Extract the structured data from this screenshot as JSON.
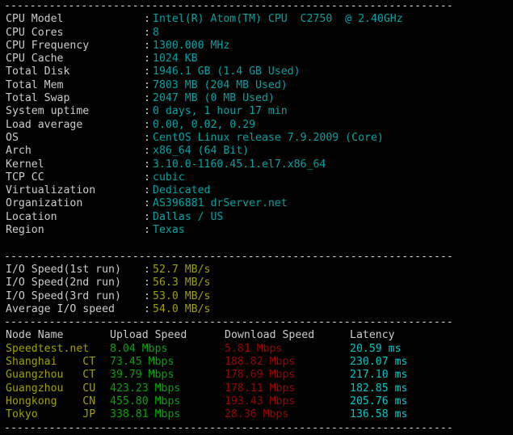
{
  "terminal": {
    "separator": "----------------------------------------------------------------------",
    "colon": ":"
  },
  "system_info": {
    "rows": [
      {
        "label": "CPU Model",
        "value": "Intel(R) Atom(TM) CPU  C2750  @ 2.40GHz"
      },
      {
        "label": "CPU Cores",
        "value": "8"
      },
      {
        "label": "CPU Frequency",
        "value": "1300.000 MHz"
      },
      {
        "label": "CPU Cache",
        "value": "1024 KB"
      },
      {
        "label": "Total Disk",
        "value": "1946.1 GB (1.4 GB Used)"
      },
      {
        "label": "Total Mem",
        "value": "7803 MB (204 MB Used)"
      },
      {
        "label": "Total Swap",
        "value": "2047 MB (0 MB Used)"
      },
      {
        "label": "System uptime",
        "value": "0 days, 1 hour 17 min"
      },
      {
        "label": "Load average",
        "value": "0.00, 0.02, 0.29"
      },
      {
        "label": "OS",
        "value": "CentOS Linux release 7.9.2009 (Core)"
      },
      {
        "label": "Arch",
        "value": "x86_64 (64 Bit)"
      },
      {
        "label": "Kernel",
        "value": "3.10.0-1160.45.1.el7.x86_64"
      },
      {
        "label": "TCP CC",
        "value": "cubic"
      },
      {
        "label": "Virtualization",
        "value": "Dedicated"
      },
      {
        "label": "Organization",
        "value": "AS396881 drServer.net"
      },
      {
        "label": "Location",
        "value": "Dallas / US"
      },
      {
        "label": "Region",
        "value": "Texas"
      }
    ]
  },
  "io_test": {
    "rows": [
      {
        "label": "I/O Speed(1st run)",
        "value": "52.7 MB/s"
      },
      {
        "label": "I/O Speed(2nd run)",
        "value": "56.3 MB/s"
      },
      {
        "label": "I/O Speed(3rd run)",
        "value": "53.0 MB/s"
      },
      {
        "label": "Average I/O speed",
        "value": "54.0 MB/s"
      }
    ]
  },
  "speedtest": {
    "headers": {
      "node": "Node Name",
      "upload": "Upload Speed",
      "download": "Download Speed",
      "latency": "Latency"
    },
    "rows": [
      {
        "node": "Speedtest.net",
        "upload": "8.04 Mbps",
        "download": "5.81 Mbps",
        "latency": "20.59 ms"
      },
      {
        "node": "Shanghai    CT",
        "upload": "73.45 Mbps",
        "download": "188.82 Mbps",
        "latency": "230.07 ms"
      },
      {
        "node": "Guangzhou   CT",
        "upload": "39.79 Mbps",
        "download": "178.69 Mbps",
        "latency": "217.10 ms"
      },
      {
        "node": "Guangzhou   CU",
        "upload": "423.23 Mbps",
        "download": "178.11 Mbps",
        "latency": "182.85 ms"
      },
      {
        "node": "Hongkong    CN",
        "upload": "455.80 Mbps",
        "download": "193.43 Mbps",
        "latency": "205.76 ms"
      },
      {
        "node": "Tokyo       JP",
        "upload": "338.81 Mbps",
        "download": "28.36 Mbps",
        "latency": "136.58 ms"
      }
    ]
  },
  "colors": {
    "background": "#000000",
    "label_text": "#cccccc",
    "value_cyan": "#00a3a3",
    "io_olive": "#a0a000",
    "node_olive": "#a0a000",
    "upload_green": "#00a800",
    "download_red": "#a00000",
    "latency_cyan": "#00c5c5",
    "separator": "#d8d8d8"
  }
}
